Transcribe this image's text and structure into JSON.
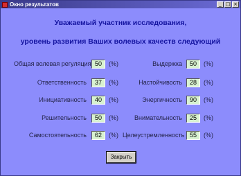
{
  "window": {
    "title": "Окно результатов",
    "buttons": {
      "minimize": "_",
      "maximize": "□",
      "close": "×"
    }
  },
  "header": {
    "line1": "Уважаемый участник исследования,",
    "line2": "уровень развития Ваших волевых качеств следующий"
  },
  "percent_sign": "(%)",
  "left_items": [
    {
      "label": "Общая волевая регуляция",
      "value": "50"
    },
    {
      "label": "Ответственность",
      "value": "37"
    },
    {
      "label": "Инициативность",
      "value": "40"
    },
    {
      "label": "Решительность",
      "value": "50"
    },
    {
      "label": "Самостоятельность",
      "value": "62"
    }
  ],
  "right_items": [
    {
      "label": "Выдержка",
      "value": "50"
    },
    {
      "label": "Настойчивость",
      "value": "28"
    },
    {
      "label": "Энергичность",
      "value": "90"
    },
    {
      "label": "Внимательность",
      "value": "25"
    },
    {
      "label": "Целеустремленность",
      "value": "55"
    }
  ],
  "close_button": "Закрыть",
  "colors": {
    "background": "#8c8cfc",
    "header_text": "#1414a0",
    "value_field": "#d8f2d0"
  }
}
